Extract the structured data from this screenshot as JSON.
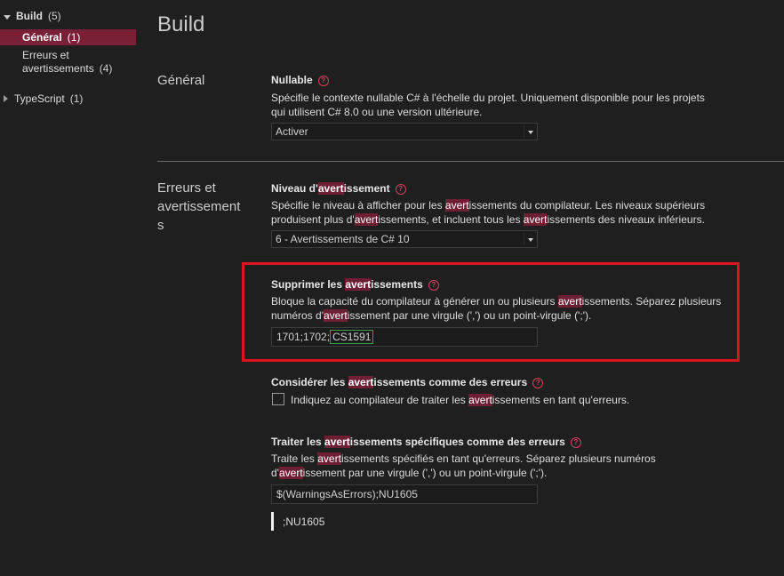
{
  "sidebar": {
    "items": [
      {
        "label": "Build",
        "count": "(5)"
      },
      {
        "label": "Général",
        "count": "(1)"
      },
      {
        "label_line1": "Erreurs et",
        "label_line2": "avertissements",
        "count": "(4)"
      },
      {
        "label": "TypeScript",
        "count": "(1)"
      }
    ]
  },
  "main": {
    "title": "Build",
    "sections": {
      "general": {
        "label": "Général"
      },
      "errors": {
        "label_line1": "Erreurs et",
        "label_line2": "avertissement",
        "label_line3": "s"
      }
    },
    "nullable": {
      "title": "Nullable",
      "desc_line1": "Spécifie le contexte nullable C# à l'échelle du projet. Uniquement disponible pour les projets",
      "desc_line2": "qui utilisent C# 8.0 ou une version ultérieure.",
      "value": "Activer"
    },
    "warning_level": {
      "title_pre": "Niveau d'",
      "title_hl": "avert",
      "title_post": "issement",
      "desc1_a": "Spécifie le niveau à afficher pour les ",
      "desc1_hl": "avert",
      "desc1_b": "issements du compilateur. Les niveaux supérieurs",
      "desc2_a": "produisent plus d'",
      "desc2_hl1": "avert",
      "desc2_b": "issements, et incluent tous les ",
      "desc2_hl2": "avert",
      "desc2_c": "issements des niveaux inférieurs.",
      "value": "6 - Avertissements de C# 10"
    },
    "suppress": {
      "title_pre": "Supprimer les ",
      "title_hl": "avert",
      "title_post": "issements",
      "desc1_a": "Bloque la capacité du compilateur à générer un ou plusieurs ",
      "desc1_hl": "avert",
      "desc1_b": "issements. Séparez plusieurs",
      "desc2_a": "numéros d'",
      "desc2_hl": "avert",
      "desc2_b": "issement par une virgule (',') ou un point-virgule (';').",
      "value_prefix": "1701;1702;",
      "value_edit": "CS1591"
    },
    "treat_as_errors": {
      "title_pre": "Considérer les ",
      "title_hl": "avert",
      "title_post": "issements comme des erreurs",
      "check_a": "Indiquez au compilateur de traiter les ",
      "check_hl": "avert",
      "check_b": "issements en tant qu'erreurs.",
      "checked": false
    },
    "specific": {
      "title_pre": "Traiter les ",
      "title_hl": "avert",
      "title_post": "issements spécifiques comme des erreurs",
      "desc1_a": "Traite les ",
      "desc1_hl": "avert",
      "desc1_b": "issements spécifiés en tant qu'erreurs. Séparez plusieurs numéros",
      "desc2_a": "d'",
      "desc2_hl": "avert",
      "desc2_b": "issement par une virgule (',') ou un point-virgule (';').",
      "value": "$(WarningsAsErrors);NU1605",
      "extra": ";NU1605"
    }
  },
  "colors": {
    "selection": "#7a2036",
    "highlight": "#6e1f33",
    "annotation_box": "#e0141e",
    "help_icon": "#d04060"
  }
}
